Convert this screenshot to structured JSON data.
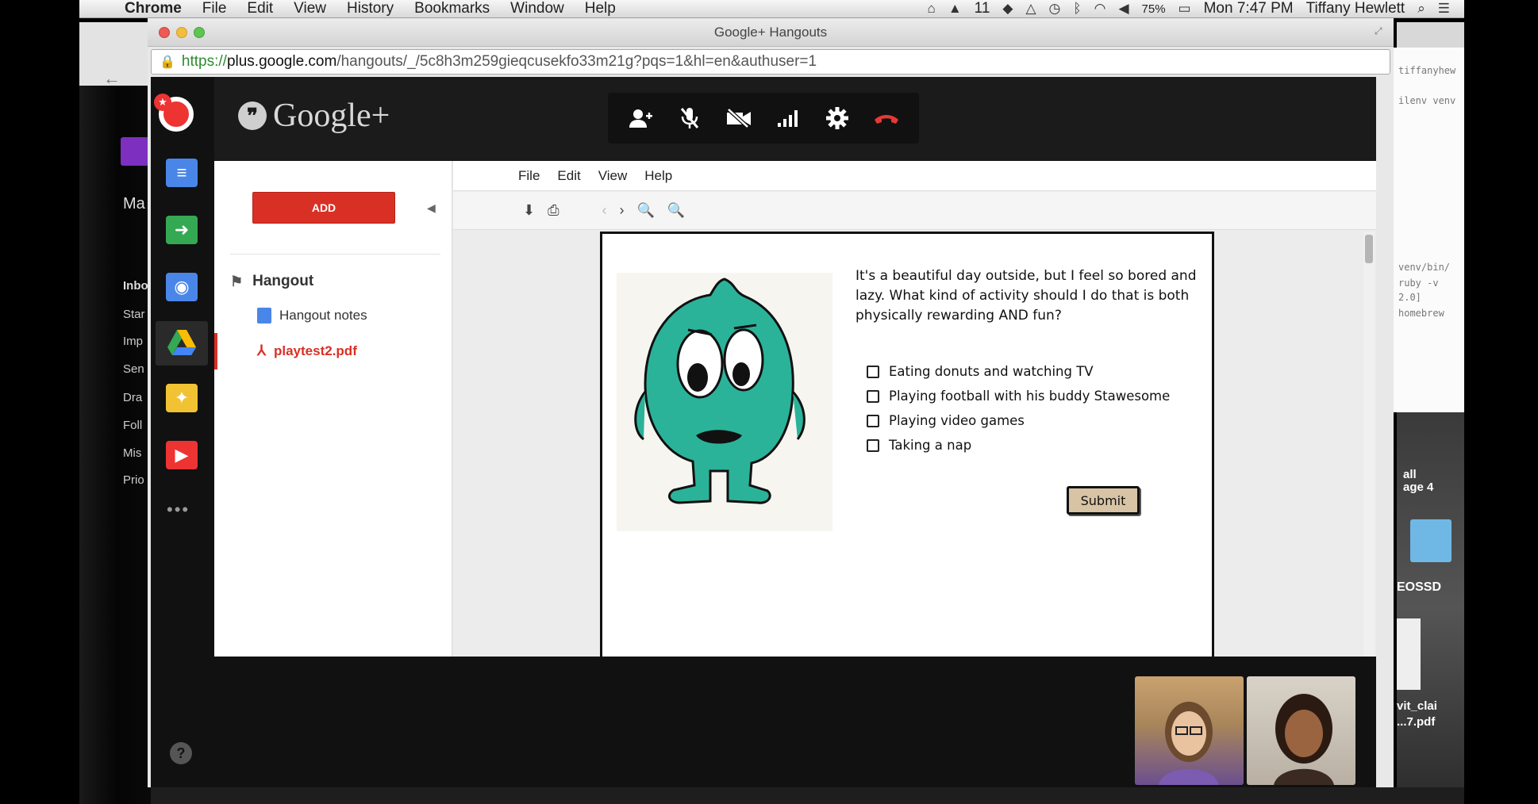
{
  "menubar": {
    "app": "Chrome",
    "items": [
      "File",
      "Edit",
      "View",
      "History",
      "Bookmarks",
      "Window",
      "Help"
    ],
    "battery": "75%",
    "clock": "Mon 7:47 PM",
    "user": "Tiffany Hewlett",
    "badge": "11"
  },
  "window": {
    "title": "Google+ Hangouts",
    "url_scheme": "https://",
    "url_host": "plus.google.com",
    "url_path": "/hangouts/_/5c8h3m259gieqcusekfo33m21g?pqs=1&hl=en&authuser=1"
  },
  "app": {
    "brand": "Google+",
    "toolbar": [
      "invite-people-icon",
      "mute-mic-icon",
      "camera-off-icon",
      "bandwidth-icon",
      "settings-icon",
      "hang-up-icon"
    ]
  },
  "sidebar": {
    "add_label": "ADD",
    "section_title": "Hangout",
    "items": [
      {
        "label": "Hangout notes",
        "icon": "docs-icon"
      },
      {
        "label": "playtest2.pdf",
        "icon": "pdf-icon"
      }
    ]
  },
  "viewer": {
    "menu": [
      "File",
      "Edit",
      "View",
      "Help"
    ],
    "tools": [
      "download-icon",
      "print-icon",
      "prev-page-icon",
      "next-page-icon",
      "zoom-out-icon",
      "zoom-in-icon"
    ]
  },
  "document": {
    "question": "It's a beautiful day outside, but I feel so bored and lazy. What kind of activity should I do that is both physically rewarding AND fun?",
    "options": [
      "Eating donuts and watching TV",
      "Playing football with his buddy Stawesome",
      "Playing video games",
      "Taking a nap"
    ],
    "submit_label": "Submit"
  },
  "desktop": {
    "left_labels": [
      "Ma",
      "Inbo",
      "Star",
      "Imp",
      "Sen",
      "Dra",
      "Foll",
      "Mis",
      "Prio"
    ],
    "right_labels": [
      "tiffanyhew",
      "ilenv venv",
      "venv/bin/",
      "ruby -v",
      "2.0]",
      "homebrew",
      "all",
      "age 4",
      "EOSSD",
      "vit_clai",
      "...7.pdf"
    ]
  },
  "colors": {
    "accent_red": "#d93025",
    "header_bg": "#1b1b1b",
    "creature": "#2bb39a"
  }
}
